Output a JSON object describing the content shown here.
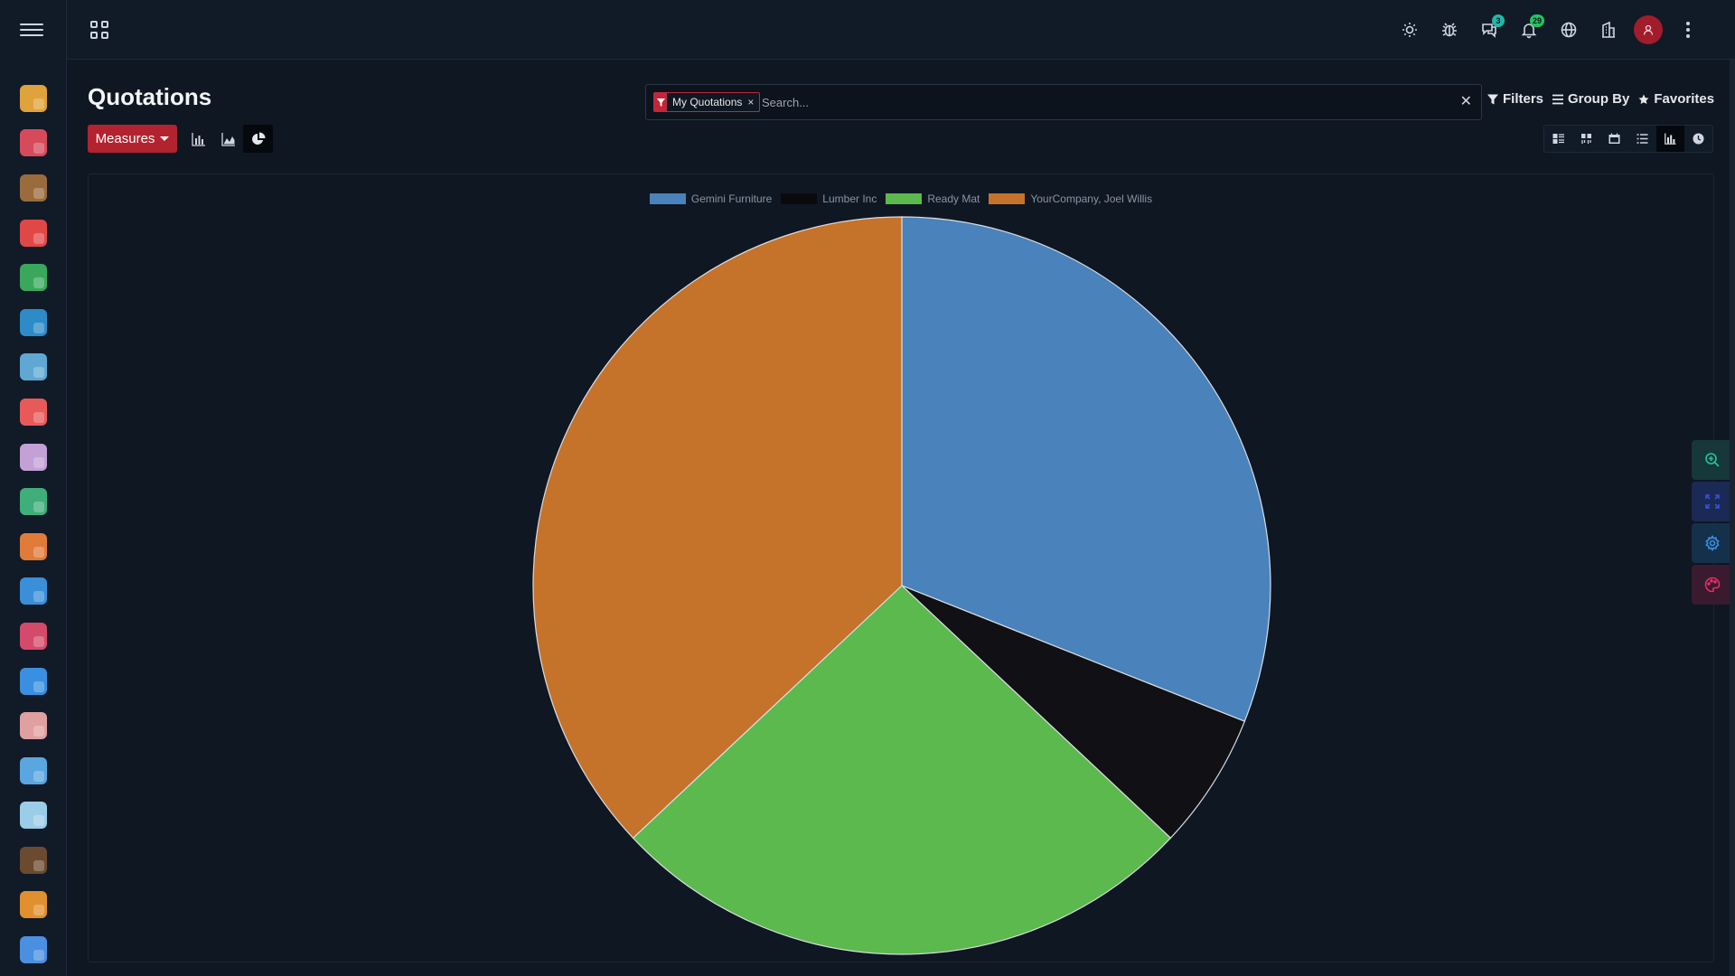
{
  "page": {
    "title": "Quotations"
  },
  "search": {
    "facet_label": "My Quotations",
    "facet_remove": "×",
    "placeholder": "Search...",
    "value": "",
    "clear_label": "✕"
  },
  "search_options": {
    "filters": "Filters",
    "group_by": "Group By",
    "favorites": "Favorites"
  },
  "toolbar": {
    "measures_label": "Measures",
    "chart_types": [
      "bar-chart-icon",
      "line-chart-icon",
      "pie-chart-icon"
    ],
    "active_chart_type": "pie-chart-icon"
  },
  "view_switcher": {
    "views": [
      "kanban-icon",
      "list-outline-icon",
      "calendar-icon",
      "list-icon",
      "graph-icon",
      "activity-icon"
    ],
    "active_view": "graph-icon"
  },
  "systray": {
    "chat_badge": "3",
    "notification_badge": "29"
  },
  "sidebar": {
    "apps": [
      {
        "name": "app-discuss",
        "color": "#e0a23a"
      },
      {
        "name": "app-calendar",
        "color": "#d64b5b"
      },
      {
        "name": "app-contacts",
        "color": "#9a6b3c"
      },
      {
        "name": "app-crm",
        "color": "#e04848"
      },
      {
        "name": "app-sales",
        "color": "#3aa85c"
      },
      {
        "name": "app-pos",
        "color": "#2d8bc7"
      },
      {
        "name": "app-invoicing",
        "color": "#5fa8d3"
      },
      {
        "name": "app-project",
        "color": "#e85a5a"
      },
      {
        "name": "app-timesheets",
        "color": "#c3a0d6"
      },
      {
        "name": "app-purchase",
        "color": "#3fae7a"
      },
      {
        "name": "app-inventory",
        "color": "#e07b3a"
      },
      {
        "name": "app-manufacturing",
        "color": "#3b8fd8"
      },
      {
        "name": "app-repairs",
        "color": "#d44a6a"
      },
      {
        "name": "app-settings-tools",
        "color": "#3a8fe0"
      },
      {
        "name": "app-employees",
        "color": "#e0a0a0"
      },
      {
        "name": "app-fleet",
        "color": "#5aa6e0"
      },
      {
        "name": "app-time-off",
        "color": "#9ccde8"
      },
      {
        "name": "app-expenses",
        "color": "#6b4a2f"
      },
      {
        "name": "app-appraisals",
        "color": "#e0902f"
      },
      {
        "name": "app-livechat",
        "color": "#4a8fe0"
      }
    ]
  },
  "chart_data": {
    "type": "pie",
    "categories": [
      "Gemini Furniture",
      "Lumber Inc",
      "Ready Mat",
      "YourCompany, Joel Willis"
    ],
    "values": [
      31,
      6,
      26,
      37
    ],
    "colors": [
      "#4a82bb",
      "#111115",
      "#5cb94d",
      "#c5722b"
    ],
    "legend_position": "top"
  }
}
